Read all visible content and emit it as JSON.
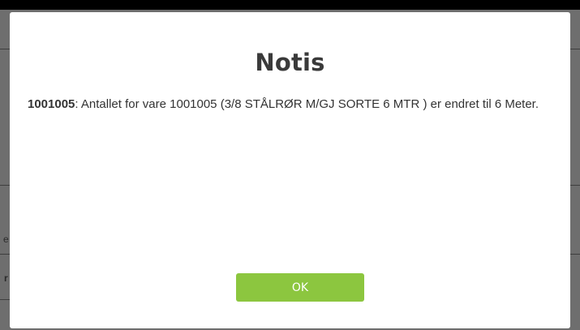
{
  "background": {
    "edge_glyphs": [
      "e",
      "r"
    ]
  },
  "modal": {
    "title": "Notis",
    "message": {
      "code": "1001005",
      "text": ": Antallet for vare 1001005 (3/8 STÅLRØR M/GJ SORTE 6 MTR ) er endret til 6 Meter."
    },
    "ok_label": "OK"
  },
  "colors": {
    "ok_button": "#8cc63f",
    "title_text": "#3a3a3a",
    "backdrop": "#6e6e6e"
  }
}
